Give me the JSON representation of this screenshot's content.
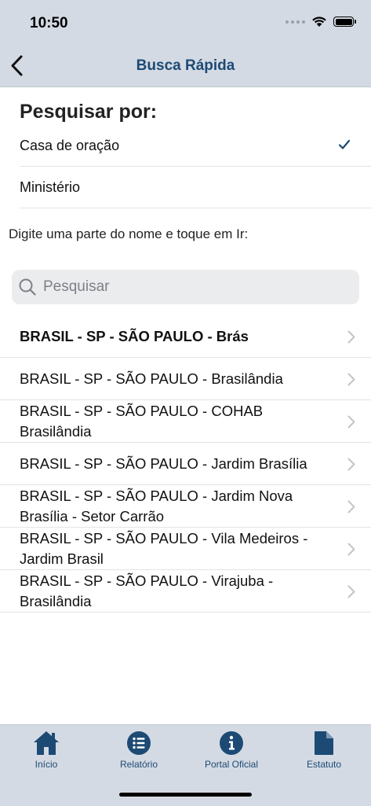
{
  "status_bar": {
    "time": "10:50"
  },
  "nav": {
    "title": "Busca Rápida",
    "back_icon": "chevron-left-icon"
  },
  "search_by": {
    "title": "Pesquisar por:",
    "options": [
      {
        "label": "Casa de oração",
        "selected": true
      },
      {
        "label": "Ministério",
        "selected": false
      }
    ]
  },
  "instruction": "Digite uma parte do nome e toque em Ir:",
  "search": {
    "placeholder": "Pesquisar",
    "value": ""
  },
  "results": [
    {
      "label": "BRASIL - SP - SÃO PAULO - Brás",
      "bold": true
    },
    {
      "label": "BRASIL - SP - SÃO PAULO - Brasilândia",
      "bold": false
    },
    {
      "label": "BRASIL - SP - SÃO PAULO - COHAB Brasilândia",
      "bold": false
    },
    {
      "label": "BRASIL - SP - SÃO PAULO - Jardim Brasília",
      "bold": false
    },
    {
      "label": "BRASIL - SP - SÃO PAULO - Jardim Nova Brasília - Setor Carrão",
      "bold": false
    },
    {
      "label": "BRASIL - SP - SÃO PAULO - Vila Medeiros - Jardim Brasil",
      "bold": false
    },
    {
      "label": "BRASIL - SP - SÃO PAULO - Virajuba - Brasilândia",
      "bold": false
    }
  ],
  "tabs": [
    {
      "label": "Início",
      "icon": "home-icon"
    },
    {
      "label": "Relatório",
      "icon": "list-icon"
    },
    {
      "label": "Portal Oficial",
      "icon": "info-icon"
    },
    {
      "label": "Estatuto",
      "icon": "document-icon"
    }
  ],
  "colors": {
    "accent": "#1d4a75",
    "bar_background": "#d4dae3",
    "search_field": "#ebecee"
  }
}
